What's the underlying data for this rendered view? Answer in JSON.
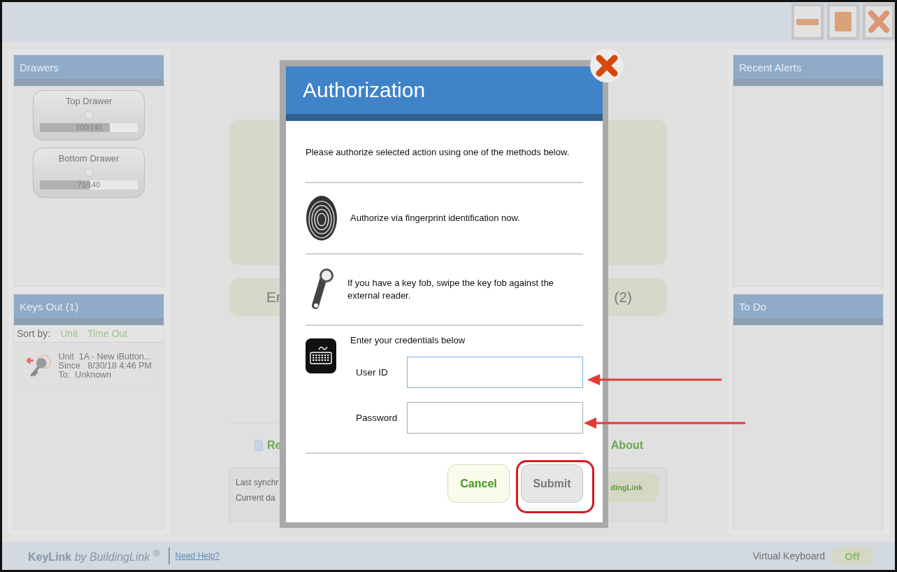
{
  "left": {
    "drawers": {
      "title": "Drawers",
      "items": [
        {
          "name": "Top Drawer",
          "count": "100/140",
          "level": 0.714
        },
        {
          "name": "Bottom Drawer",
          "count": "71/140",
          "level": 0.507
        }
      ]
    },
    "keys_out": {
      "title": "Keys Out (1)",
      "sort_label": "Sort by:",
      "sort_options": [
        "Unit",
        "Time Out"
      ],
      "items": [
        {
          "lines": [
            "Unit  1A - New iButton...",
            "Since   8/30/18 4:46 PM",
            "To:  Unknown"
          ]
        }
      ]
    }
  },
  "center": {
    "card_left": "Er",
    "card_right": "(2)",
    "links": [
      "Re",
      "About"
    ],
    "sync_lines": [
      "Last synchr",
      "Current da"
    ],
    "sync_badge": "dingLink"
  },
  "right": {
    "panels": [
      "Recent Alerts",
      "To Do"
    ]
  },
  "dialog": {
    "title": "Authorization",
    "intro": "Please authorize selected action using one of the methods below.",
    "methods": [
      {
        "kind": "fingerprint",
        "text": "Authorize via fingerprint identification now."
      },
      {
        "kind": "keyfob",
        "text": "If you have a key fob, swipe the key fob against the external reader."
      },
      {
        "kind": "keyboard",
        "text": "Enter your credentials below",
        "fields": [
          {
            "label": "User ID",
            "focused": true
          },
          {
            "label": "Password",
            "focused": false
          }
        ]
      }
    ],
    "buttons": [
      {
        "label": "Cancel",
        "disabled": false
      },
      {
        "label": "Submit",
        "disabled": true
      }
    ]
  },
  "footer": {
    "brand": "**KeyLink** *by BuildingLink* $^{®}$",
    "help": "Need Help?",
    "keyboard_label": "Virtual Keyboard",
    "keyboard_toggle": {
      "label": "Off",
      "on": false
    }
  }
}
